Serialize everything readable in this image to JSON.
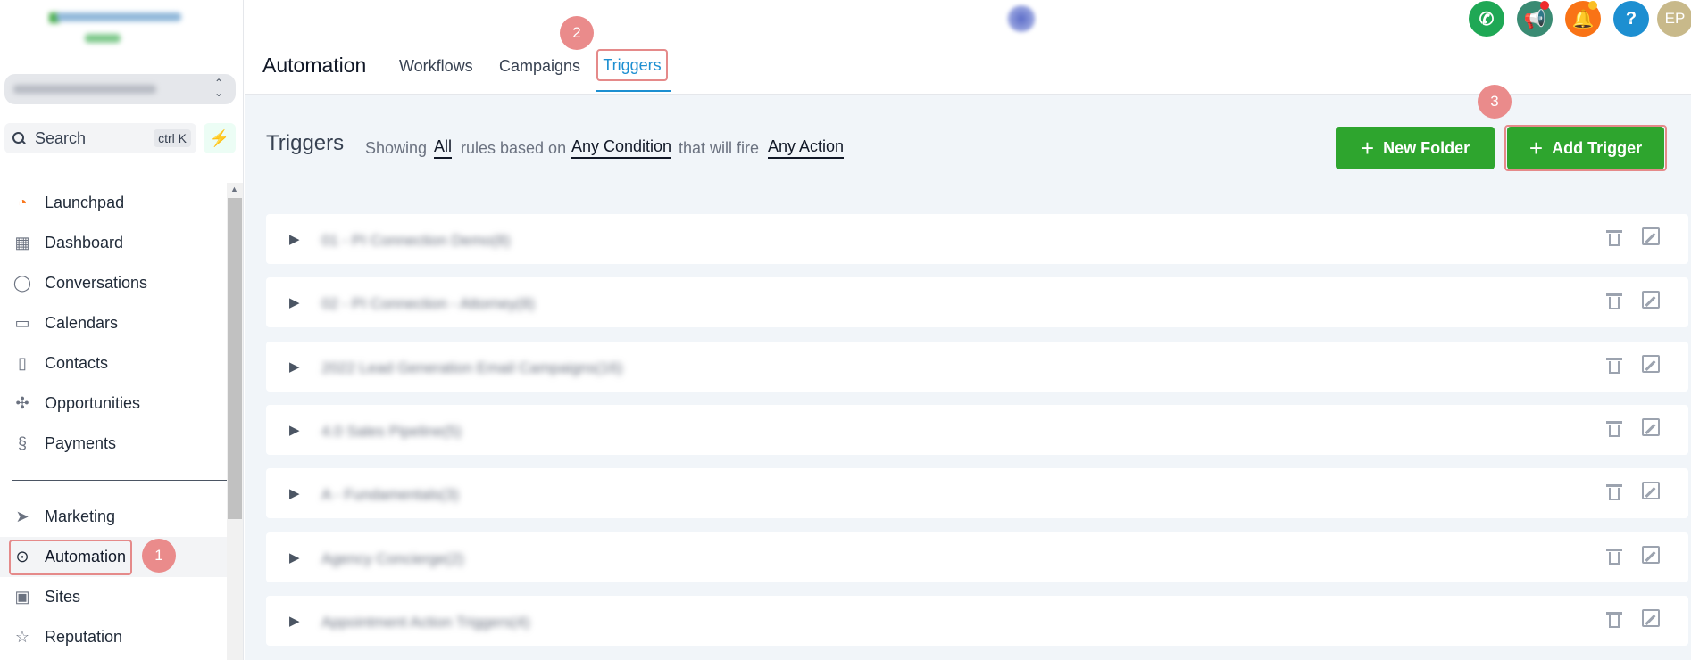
{
  "sidebar": {
    "search_label": "Search",
    "search_shortcut": "ctrl K",
    "nav_primary": [
      {
        "label": "Launchpad",
        "icon": "launchpad-icon"
      },
      {
        "label": "Dashboard",
        "icon": "dashboard-icon"
      },
      {
        "label": "Conversations",
        "icon": "chat-bubble-icon"
      },
      {
        "label": "Calendars",
        "icon": "calendar-icon"
      },
      {
        "label": "Contacts",
        "icon": "contacts-icon"
      },
      {
        "label": "Opportunities",
        "icon": "opportunities-icon"
      },
      {
        "label": "Payments",
        "icon": "payments-icon"
      }
    ],
    "nav_secondary": [
      {
        "label": "Marketing",
        "icon": "send-icon"
      },
      {
        "label": "Automation",
        "icon": "automation-icon"
      },
      {
        "label": "Sites",
        "icon": "sites-icon"
      },
      {
        "label": "Reputation",
        "icon": "star-icon"
      }
    ]
  },
  "header": {
    "title": "Automation",
    "tabs": {
      "workflows": "Workflows",
      "campaigns": "Campaigns",
      "triggers": "Triggers"
    },
    "avatar_initials": "EP",
    "help_label": "?",
    "colors": {
      "phone": "#1fa855",
      "megaphone": "#3a8b73",
      "bell": "#f97316",
      "help": "#1d8fd1",
      "avatar": "#c8b98a"
    }
  },
  "badges": {
    "one": "1",
    "two": "2",
    "three": "3"
  },
  "main": {
    "title": "Triggers",
    "filter": {
      "showing": "Showing",
      "all": "All",
      "rules_based_on": "rules based on",
      "any_condition": "Any Condition",
      "that_will_fire": "that will fire",
      "any_action": "Any Action"
    },
    "new_folder": "New Folder",
    "add_trigger": "Add Trigger",
    "folders": [
      "01 - PI Connection Demo(8)",
      "02 - PI Connection - Attorney(8)",
      "2022 Lead Generation Email Campaigns(16)",
      "4.0 Sales Pipeline(5)",
      "A - Fundamentals(3)",
      "Agency Concierge(2)",
      "Appointment Action Triggers(4)"
    ]
  }
}
